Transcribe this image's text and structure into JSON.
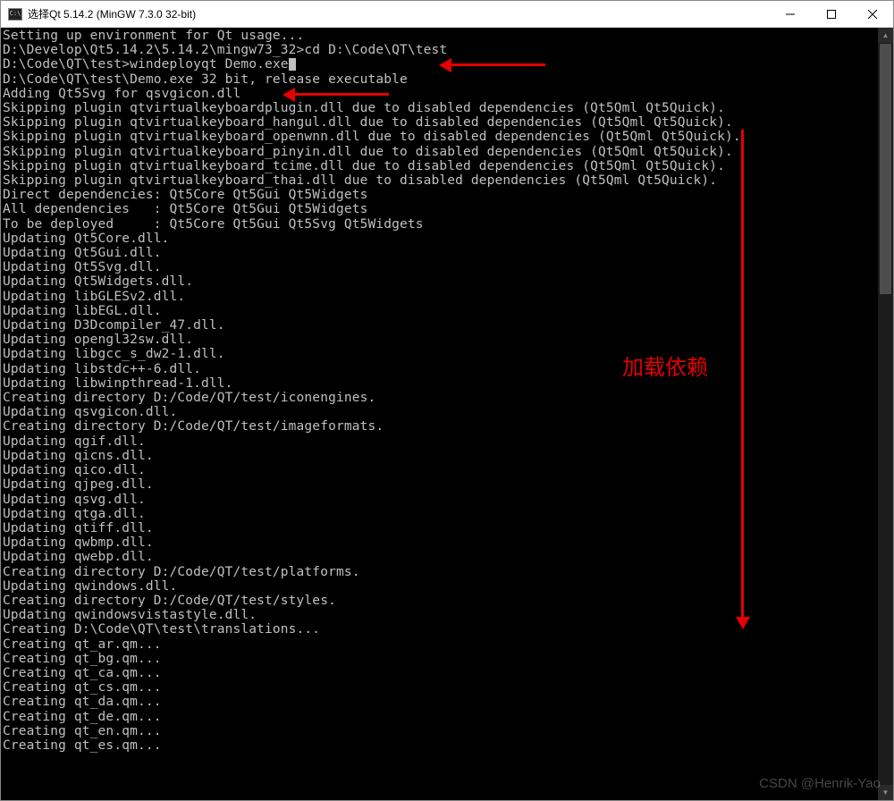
{
  "window": {
    "icon_text": "C:\\",
    "title": "选择Qt 5.14.2 (MinGW 7.3.0 32-bit)"
  },
  "terminal": {
    "lines": [
      "Setting up environment for Qt usage...",
      "",
      "D:\\Develop\\Qt5.14.2\\5.14.2\\mingw73_32>cd D:\\Code\\QT\\test",
      "",
      "D:\\Code\\QT\\test>windeployqt Demo.exe",
      "D:\\Code\\QT\\test\\Demo.exe 32 bit, release executable",
      "Adding Qt5Svg for qsvgicon.dll",
      "Skipping plugin qtvirtualkeyboardplugin.dll due to disabled dependencies (Qt5Qml Qt5Quick).",
      "Skipping plugin qtvirtualkeyboard_hangul.dll due to disabled dependencies (Qt5Qml Qt5Quick).",
      "Skipping plugin qtvirtualkeyboard_openwnn.dll due to disabled dependencies (Qt5Qml Qt5Quick).",
      "Skipping plugin qtvirtualkeyboard_pinyin.dll due to disabled dependencies (Qt5Qml Qt5Quick).",
      "Skipping plugin qtvirtualkeyboard_tcime.dll due to disabled dependencies (Qt5Qml Qt5Quick).",
      "Skipping plugin qtvirtualkeyboard_thai.dll due to disabled dependencies (Qt5Qml Qt5Quick).",
      "Direct dependencies: Qt5Core Qt5Gui Qt5Widgets",
      "All dependencies   : Qt5Core Qt5Gui Qt5Widgets",
      "To be deployed     : Qt5Core Qt5Gui Qt5Svg Qt5Widgets",
      "Updating Qt5Core.dll.",
      "Updating Qt5Gui.dll.",
      "Updating Qt5Svg.dll.",
      "Updating Qt5Widgets.dll.",
      "Updating libGLESv2.dll.",
      "Updating libEGL.dll.",
      "Updating D3Dcompiler_47.dll.",
      "Updating opengl32sw.dll.",
      "Updating libgcc_s_dw2-1.dll.",
      "Updating libstdc++-6.dll.",
      "Updating libwinpthread-1.dll.",
      "Creating directory D:/Code/QT/test/iconengines.",
      "Updating qsvgicon.dll.",
      "Creating directory D:/Code/QT/test/imageformats.",
      "Updating qgif.dll.",
      "Updating qicns.dll.",
      "Updating qico.dll.",
      "Updating qjpeg.dll.",
      "Updating qsvg.dll.",
      "Updating qtga.dll.",
      "Updating qtiff.dll.",
      "Updating qwbmp.dll.",
      "Updating qwebp.dll.",
      "Creating directory D:/Code/QT/test/platforms.",
      "Updating qwindows.dll.",
      "Creating directory D:/Code/QT/test/styles.",
      "Updating qwindowsvistastyle.dll.",
      "Creating D:\\Code\\QT\\test\\translations...",
      "Creating qt_ar.qm...",
      "Creating qt_bg.qm...",
      "Creating qt_ca.qm...",
      "Creating qt_cs.qm...",
      "Creating qt_da.qm...",
      "Creating qt_de.qm...",
      "Creating qt_en.qm...",
      "Creating qt_es.qm..."
    ],
    "cursor_line_index": 4
  },
  "annotations": {
    "label": "加载依赖"
  },
  "watermark": "CSDN @Henrik-Yao"
}
